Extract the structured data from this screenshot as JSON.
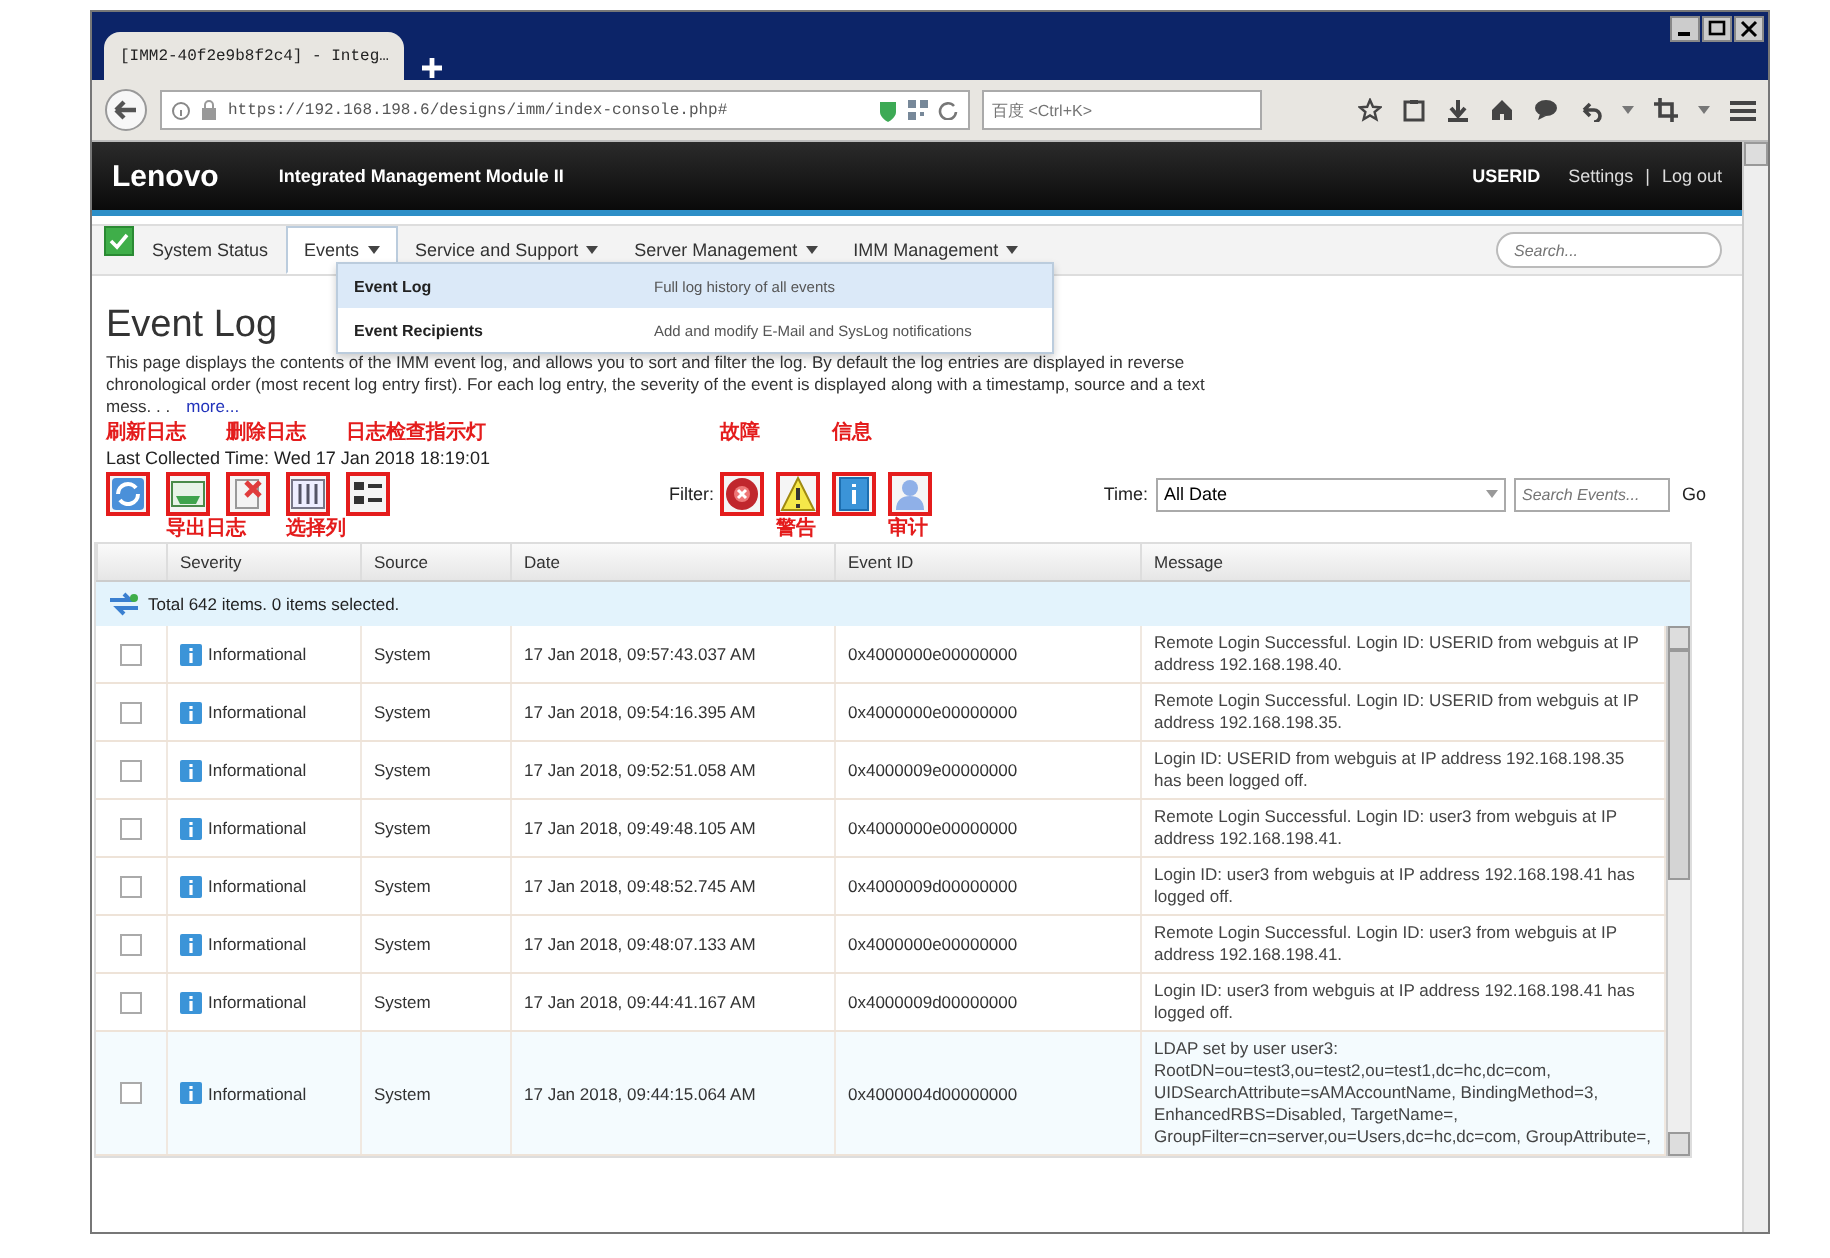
{
  "browser": {
    "tab_title": "[IMM2-40f2e9b8f2c4] - Integ…",
    "url": "https://192.168.198.6/designs/imm/index-console.php#",
    "search_placeholder": "百度 <Ctrl+K>"
  },
  "header": {
    "brand": "Lenovo",
    "product": "Integrated Management Module II",
    "user": "USERID",
    "links": [
      "Settings",
      "Log out"
    ],
    "separator": "|"
  },
  "nav": {
    "items": [
      {
        "label": "System Status",
        "selected": false,
        "has_menu": false
      },
      {
        "label": "Events",
        "selected": true,
        "has_menu": true
      },
      {
        "label": "Service and Support",
        "selected": false,
        "has_menu": true
      },
      {
        "label": "Server Management",
        "selected": false,
        "has_menu": true
      },
      {
        "label": "IMM Management",
        "selected": false,
        "has_menu": true
      }
    ],
    "search": {
      "placeholder": "Search..."
    }
  },
  "menu": {
    "items": [
      {
        "label": "Event Log",
        "description": "Full log history of all events",
        "selected": true
      },
      {
        "label": "Event Recipients",
        "description": "Add and modify E-Mail and SysLog notifications",
        "selected": false
      }
    ]
  },
  "page": {
    "title": "Event Log",
    "description": "This page displays the contents of the IMM event log, and allows you to sort and filter the log. By default the log entries are displayed in reverse chronological order (most recent log entry first). For each log entry, the severity of the event is displayed along with a timestamp, source and a text mess. . .",
    "more_link": "more...",
    "last_collected": "Last Collected Time: Wed 17 Jan 2018 18:19:01"
  },
  "toolbar": {
    "buttons": [
      {
        "kind": "refresh",
        "note_above": "刷新日志"
      },
      {
        "kind": "export",
        "note_below": "导出日志"
      },
      {
        "kind": "delete",
        "note_above": "删除日志"
      },
      {
        "kind": "columns",
        "note_below": "选择列"
      },
      {
        "kind": "layout",
        "note_above": "日志检查指示灯"
      }
    ],
    "filter_label": "Filter:",
    "filters": [
      {
        "kind": "error",
        "note_above": "故障"
      },
      {
        "kind": "warning",
        "note_below": "警告"
      },
      {
        "kind": "info",
        "note_above": "信息"
      },
      {
        "kind": "audit",
        "note_below": "审计"
      }
    ],
    "time_label": "Time:",
    "time_value": "All Date",
    "search_placeholder": "Search Events...",
    "go": "Go"
  },
  "table": {
    "columns": [
      "Severity",
      "Source",
      "Date",
      "Event ID",
      "Message"
    ],
    "summary": "Total 642 items. 0 items selected.",
    "rows": [
      {
        "checked": false,
        "severity": "Informational",
        "source": "System",
        "date": "17 Jan 2018, 09:57:43.037 AM",
        "event_id": "0x4000000e00000000",
        "message": "Remote Login Successful. Login ID: USERID from webguis at IP address 192.168.198.40."
      },
      {
        "checked": false,
        "severity": "Informational",
        "source": "System",
        "date": "17 Jan 2018, 09:54:16.395 AM",
        "event_id": "0x4000000e00000000",
        "message": "Remote Login Successful. Login ID: USERID from webguis at IP address 192.168.198.35."
      },
      {
        "checked": false,
        "severity": "Informational",
        "source": "System",
        "date": "17 Jan 2018, 09:52:51.058 AM",
        "event_id": "0x4000009e00000000",
        "message": "Login ID: USERID from webguis at IP address 192.168.198.35 has been logged off."
      },
      {
        "checked": false,
        "severity": "Informational",
        "source": "System",
        "date": "17 Jan 2018, 09:49:48.105 AM",
        "event_id": "0x4000000e00000000",
        "message": "Remote Login Successful. Login ID: user3 from webguis at IP address 192.168.198.41."
      },
      {
        "checked": false,
        "severity": "Informational",
        "source": "System",
        "date": "17 Jan 2018, 09:48:52.745 AM",
        "event_id": "0x4000009d00000000",
        "message": "Login ID: user3 from webguis at IP address 192.168.198.41 has logged off."
      },
      {
        "checked": false,
        "severity": "Informational",
        "source": "System",
        "date": "17 Jan 2018, 09:48:07.133 AM",
        "event_id": "0x4000000e00000000",
        "message": "Remote Login Successful. Login ID: user3 from webguis at IP address 192.168.198.41."
      },
      {
        "checked": false,
        "severity": "Informational",
        "source": "System",
        "date": "17 Jan 2018, 09:44:41.167 AM",
        "event_id": "0x4000009d00000000",
        "message": "Login ID: user3 from webguis at IP address 192.168.198.41 has logged off."
      },
      {
        "checked": false,
        "severity": "Informational",
        "source": "System",
        "date": "17 Jan 2018, 09:44:15.064 AM",
        "event_id": "0x4000004d00000000",
        "message": "LDAP set by user user3: RootDN=ou=test3,ou=test2,ou=test1,dc=hc,dc=com, UIDSearchAttribute=sAMAccountName, BindingMethod=3, EnhancedRBS=Disabled, TargetName=, GroupFilter=cn=server,ou=Users,dc=hc,dc=com, GroupAttribute=,"
      }
    ]
  }
}
